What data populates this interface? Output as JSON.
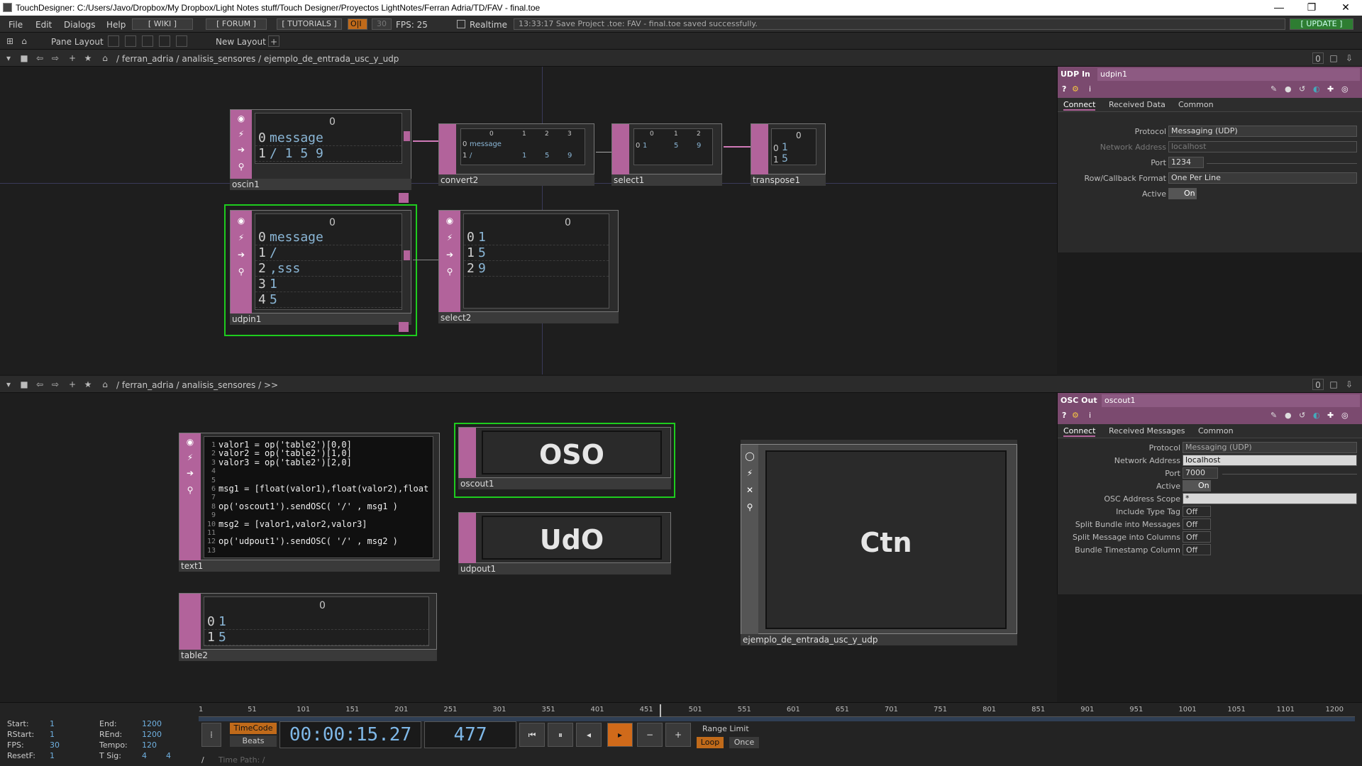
{
  "titlebar": {
    "title": "TouchDesigner: C:/Users/Javo/Dropbox/My Dropbox/Light Notes stuff/Touch Designer/Proyectos LightNotes/Ferran Adria/TD/FAV - final.toe",
    "min": "—",
    "max": "❐",
    "close": "✕"
  },
  "menubar": {
    "items": [
      "File",
      "Edit",
      "Dialogs",
      "Help"
    ],
    "wiki": "[ WIKI ]",
    "forum": "[ FORUM ]",
    "tutorials": "[ TUTORIALS ]",
    "oi": "O|I",
    "fps_box": "30",
    "fps": "FPS: 25",
    "realtime": "Realtime",
    "status": "13:33:17 Save Project .toe: FAV - final.toe saved successfully.",
    "update": "[ UPDATE ]"
  },
  "panebar": {
    "pane_layout": "Pane Layout",
    "new_layout": "New Layout"
  },
  "top_path": "/ ferran_adria / analisis_sensores / ejemplo_de_entrada_usc_y_udp",
  "bottom_path": "/ ferran_adria / analisis_sensores / >>",
  "pane_num": "0",
  "nodes": {
    "oscin1": {
      "name": "oscin1",
      "col": "0",
      "r0i": "0",
      "r0v": "message",
      "r1i": "1",
      "r1v": "/ 1 5 9"
    },
    "convert2": {
      "name": "convert2",
      "c0": "0",
      "c1": "1",
      "c2": "2",
      "c3": "3",
      "r0i": "0",
      "r0v": "message",
      "r1i": "1",
      "r1a": "/",
      "r1b": "1",
      "r1c": "5",
      "r1d": "9"
    },
    "select1": {
      "name": "select1",
      "c0": "0",
      "c1": "1",
      "c2": "2",
      "r0i": "0",
      "r0a": "1",
      "r0b": "5",
      "r0c": "9"
    },
    "transpose1": {
      "name": "transpose1",
      "col": "0",
      "r0i": "0",
      "r0v": "1",
      "r1i": "1",
      "r1v": "5"
    },
    "udpin1": {
      "name": "udpin1",
      "col": "0",
      "rows": [
        {
          "i": "0",
          "v": "message"
        },
        {
          "i": "1",
          "v": "/"
        },
        {
          "i": "2",
          "v": ",sss"
        },
        {
          "i": "3",
          "v": "1"
        },
        {
          "i": "4",
          "v": "5"
        }
      ]
    },
    "select2": {
      "name": "select2",
      "col": "0",
      "rows": [
        {
          "i": "0",
          "v": "1"
        },
        {
          "i": "1",
          "v": "5"
        },
        {
          "i": "2",
          "v": "9"
        }
      ]
    },
    "text1": {
      "name": "text1",
      "lines": [
        {
          "n": "1",
          "t": "valor1 = op('table2')[0,0]"
        },
        {
          "n": "2",
          "t": "valor2 = op('table2')[1,0]"
        },
        {
          "n": "3",
          "t": "valor3 = op('table2')[2,0]"
        },
        {
          "n": "4",
          "t": ""
        },
        {
          "n": "5",
          "t": ""
        },
        {
          "n": "6",
          "t": "msg1 = [float(valor1),float(valor2),float"
        },
        {
          "n": "7",
          "t": ""
        },
        {
          "n": "8",
          "t": "op('oscout1').sendOSC( '/' , msg1 )"
        },
        {
          "n": "9",
          "t": ""
        },
        {
          "n": "10",
          "t": "msg2 = [valor1,valor2,valor3]"
        },
        {
          "n": "11",
          "t": ""
        },
        {
          "n": "12",
          "t": "op('udpout1').sendOSC( '/' , msg2 )"
        },
        {
          "n": "13",
          "t": ""
        }
      ]
    },
    "oscout1": {
      "name": "oscout1",
      "label": "OSO"
    },
    "udpout1": {
      "name": "udpout1",
      "label": "UdO"
    },
    "table2": {
      "name": "table2",
      "col": "0",
      "r0i": "0",
      "r0v": "1",
      "r1i": "1",
      "r1v": "5"
    },
    "comp": {
      "name": "ejemplo_de_entrada_usc_y_udp",
      "label": "Ctn"
    }
  },
  "udp_panel": {
    "type": "UDP In",
    "name": "udpin1",
    "tabs": [
      "Connect",
      "Received Data",
      "Common"
    ],
    "params": [
      {
        "label": "Protocol",
        "value": "Messaging (UDP)"
      },
      {
        "label": "Network Address",
        "value": "localhost"
      },
      {
        "label": "Port",
        "value": "1234"
      },
      {
        "label": "Row/Callback Format",
        "value": "One Per Line"
      },
      {
        "label": "Active",
        "value": "On"
      }
    ]
  },
  "osc_panel": {
    "type": "OSC Out",
    "name": "oscout1",
    "tabs": [
      "Connect",
      "Received Messages",
      "Common"
    ],
    "params": [
      {
        "label": "Protocol",
        "value": "Messaging (UDP)"
      },
      {
        "label": "Network Address",
        "value": "localhost"
      },
      {
        "label": "Port",
        "value": "7000"
      },
      {
        "label": "Active",
        "value": "On"
      },
      {
        "label": "OSC Address Scope",
        "value": "*"
      },
      {
        "label": "Include Type Tag",
        "value": "Off"
      },
      {
        "label": "Split Bundle into Messages",
        "value": "Off"
      },
      {
        "label": "Split Message into Columns",
        "value": "Off"
      },
      {
        "label": "Bundle Timestamp Column",
        "value": "Off"
      }
    ]
  },
  "timeline": {
    "ruler": [
      "1",
      "51",
      "101",
      "151",
      "201",
      "251",
      "301",
      "351",
      "401",
      "451",
      "501",
      "551",
      "601",
      "651",
      "701",
      "751",
      "801",
      "851",
      "901",
      "951",
      "1001",
      "1051",
      "1101",
      "1200"
    ],
    "start_l": "Start:",
    "start": "1",
    "end_l": "End:",
    "end": "1200",
    "rstart_l": "RStart:",
    "rstart": "1",
    "rend_l": "REnd:",
    "rend": "1200",
    "fps_l": "FPS:",
    "fps": "30",
    "tempo_l": "Tempo:",
    "tempo": "120",
    "resetf_l": "ResetF:",
    "resetf": "1",
    "tsig_l": "T Sig:",
    "tsig_a": "4",
    "tsig_b": "4",
    "timecode": "TimeCode",
    "beats": "Beats",
    "time": "00:00:15.27",
    "frame": "477",
    "range_limit": "Range Limit",
    "loop": "Loop",
    "once": "Once",
    "time_path": "Time Path: /"
  }
}
